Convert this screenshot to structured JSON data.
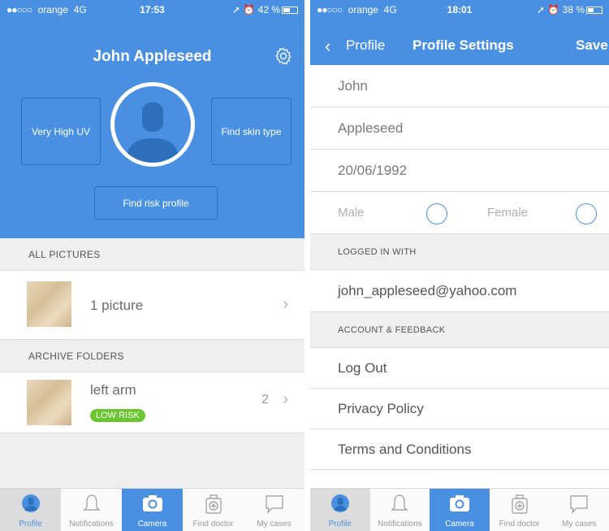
{
  "left": {
    "status": {
      "carrier": "orange",
      "network": "4G",
      "time": "17:53",
      "battery": "42 %",
      "battery_level": 0.42
    },
    "header": {
      "name": "John  Appleseed",
      "uv_label": "Very High UV",
      "skin_label": "Find skin type",
      "risk_label": "Find risk profile"
    },
    "sections": {
      "all_pictures": "ALL PICTURES",
      "archive_folders": "ARCHIVE FOLDERS"
    },
    "pictures_row": {
      "label": "1 picture"
    },
    "folder_row": {
      "label": "left arm",
      "badge": "LOW RISK",
      "count": "2"
    }
  },
  "right": {
    "status": {
      "carrier": "orange",
      "network": "4G",
      "time": "18:01",
      "battery": "38 %",
      "battery_level": 0.38
    },
    "nav": {
      "back": "Profile",
      "title": "Profile Settings",
      "save": "Save"
    },
    "form": {
      "first_name": "John",
      "last_name": "Appleseed",
      "dob": "20/06/1992",
      "male": "Male",
      "female": "Female"
    },
    "sections": {
      "logged_in": "LOGGED IN WITH",
      "account": "ACCOUNT & FEEDBACK"
    },
    "email": "john_appleseed@yahoo.com",
    "links": [
      "Log Out",
      "Privacy Policy",
      "Terms and Conditions"
    ]
  },
  "tabs": [
    "Profile",
    "Notifications",
    "Camera",
    "Find doctor",
    "My cases"
  ],
  "colors": {
    "accent": "#4a90e2",
    "badge": "#6bc730"
  }
}
